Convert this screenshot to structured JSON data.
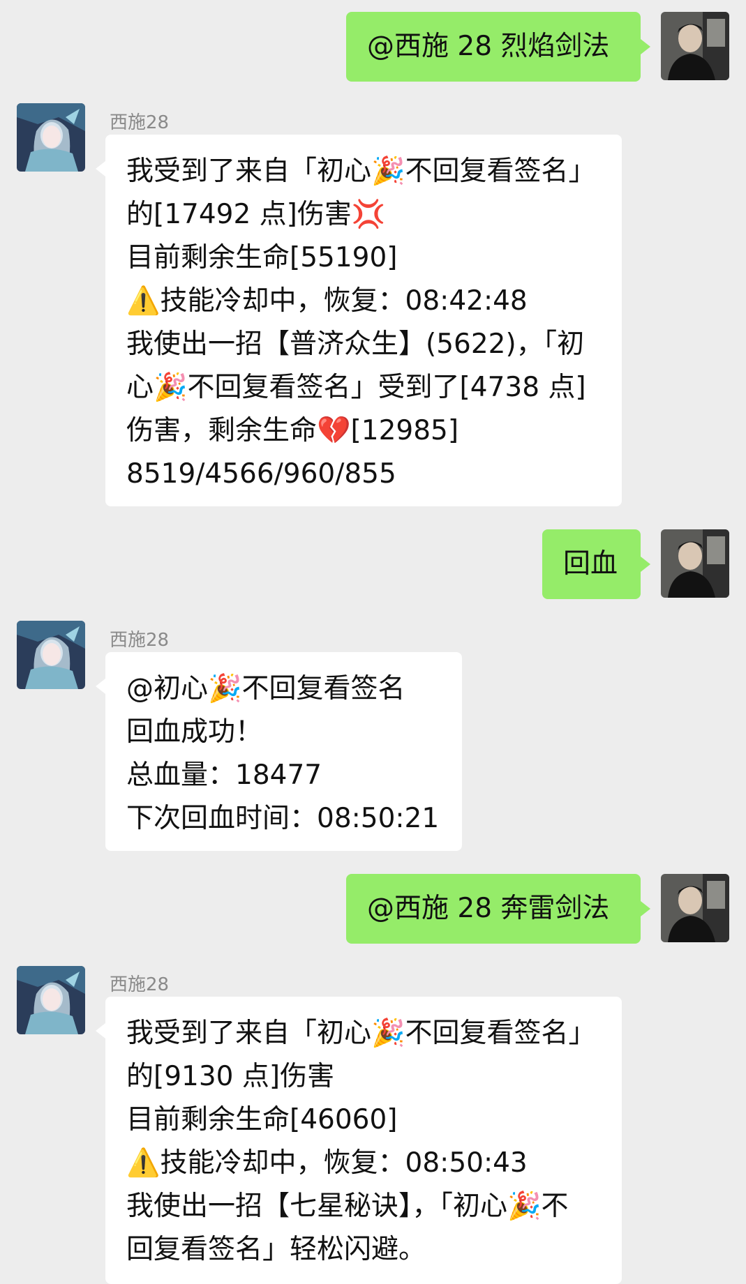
{
  "colors": {
    "background": "#ededed",
    "my_bubble": "#95ec69",
    "their_bubble": "#ffffff",
    "name_text": "#8a8a8a"
  },
  "messages": [
    {
      "side": "right",
      "text": "@西施 28  烈焰剑法"
    },
    {
      "side": "left",
      "name": "西施28",
      "lines": [
        "我受到了来自「初心🎉不回复看签名」",
        "的[17492 点]伤害💢",
        "目前剩余生命[55190]",
        "⚠️技能冷却中，恢复：08:42:48",
        "我使出一招【普济众生】(5622)，「初",
        "心🎉不回复看签名」受到了[4738 点]",
        "伤害，剩余生命💔[12985]",
        "8519/4566/960/855"
      ]
    },
    {
      "side": "right",
      "text": "回血"
    },
    {
      "side": "left",
      "name": "西施28",
      "lines": [
        "@初心🎉不回复看签名",
        "回血成功！",
        "总血量：18477",
        "下次回血时间：08:50:21"
      ]
    },
    {
      "side": "right",
      "text": "@西施 28  奔雷剑法"
    },
    {
      "side": "left",
      "name": "西施28",
      "lines": [
        "我受到了来自「初心🎉不回复看签名」",
        "的[9130 点]伤害",
        "目前剩余生命[46060]",
        "⚠️技能冷却中，恢复：08:50:43",
        "我使出一招【七星秘诀】，「初心🎉不",
        "回复看签名」轻松闪避。"
      ]
    }
  ],
  "icons": {
    "their_avatar": "anime-avatar-icon",
    "my_avatar": "user-photo-avatar-icon"
  }
}
